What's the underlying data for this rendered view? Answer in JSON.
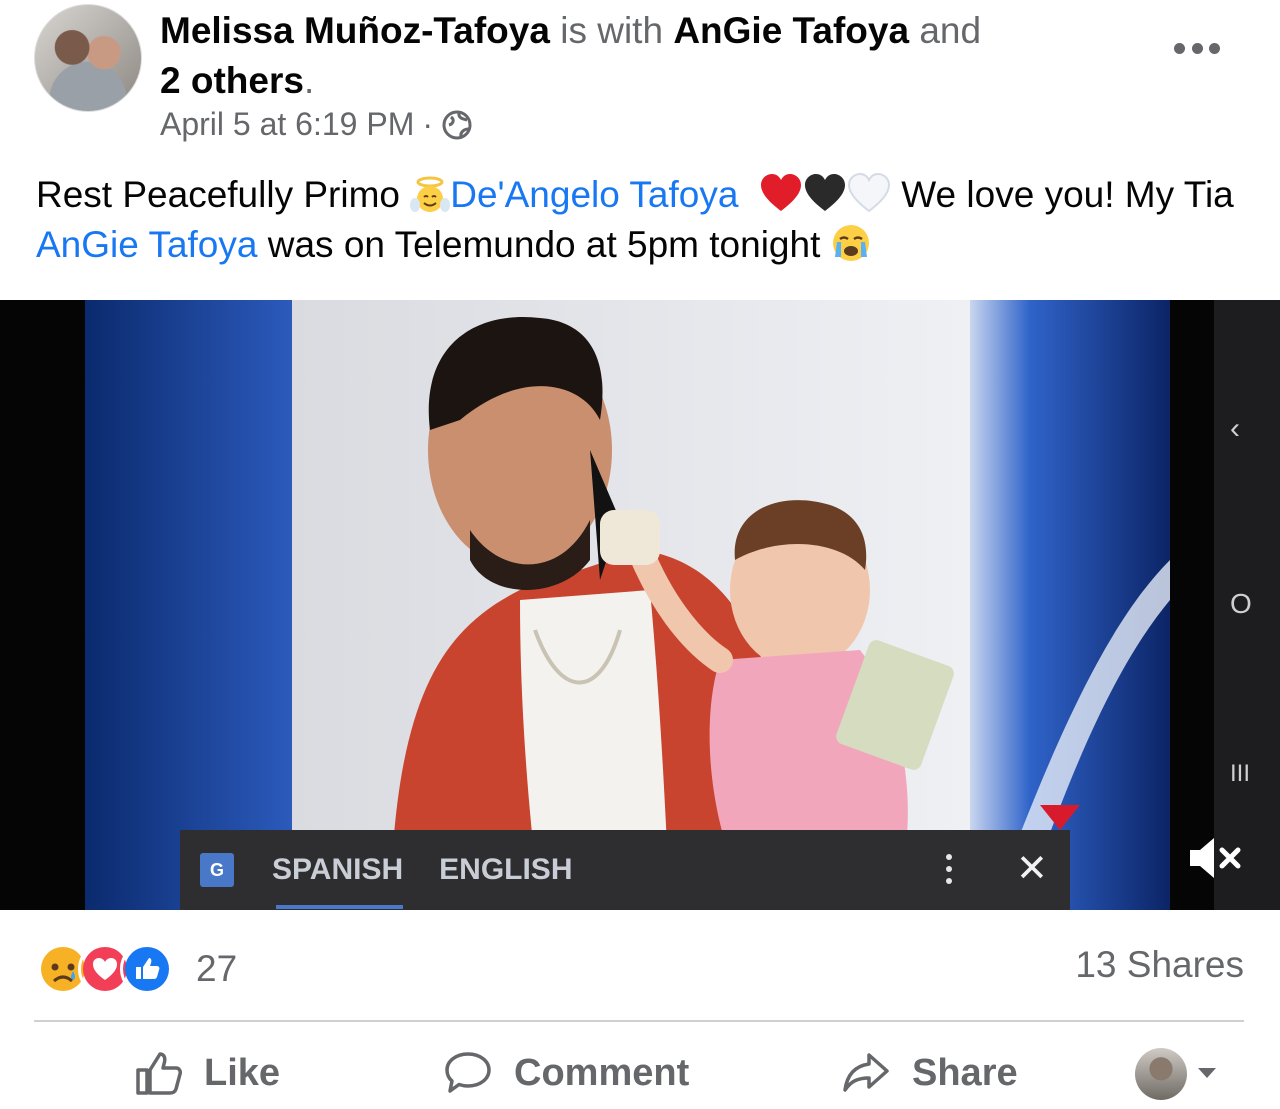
{
  "post": {
    "author": "Melissa Muñoz-Tafoya",
    "with_text": "is with",
    "tagged": "AnGie Tafoya",
    "and_text": "and",
    "others": "2 others",
    "period": ".",
    "date": "April 5 at 6:19 PM",
    "dot": "·",
    "audience_icon": "globe-icon",
    "text_part1": "Rest Peacefully Primo",
    "mention1": "De'Angelo Tafoya",
    "text_part2": "We love you! My Tia",
    "mention2": "AnGie Tafoya",
    "text_part3": "was on Telemundo at 5pm tonight",
    "emojis": [
      "angel-emoji",
      "red-heart-emoji",
      "black-heart-emoji",
      "white-heart-emoji",
      "crying-emoji"
    ]
  },
  "video": {
    "lang_spanish": "SPANISH",
    "lang_english": "ENGLISH",
    "translate_icon": "google-translate-icon",
    "nav_back": "‹",
    "nav_home": "O",
    "nav_recent": "III",
    "mute_icon": "muted-speaker-icon"
  },
  "engagement": {
    "reaction_icons": [
      "sad-reaction",
      "love-reaction",
      "like-reaction"
    ],
    "count": "27",
    "shares": "13 Shares"
  },
  "actions": {
    "like": "Like",
    "comment": "Comment",
    "share": "Share"
  },
  "colors": {
    "link": "#1877f2",
    "secondary_text": "#65676b",
    "love": "#f33e58",
    "like": "#1877f2",
    "sad": "#f7b125"
  }
}
